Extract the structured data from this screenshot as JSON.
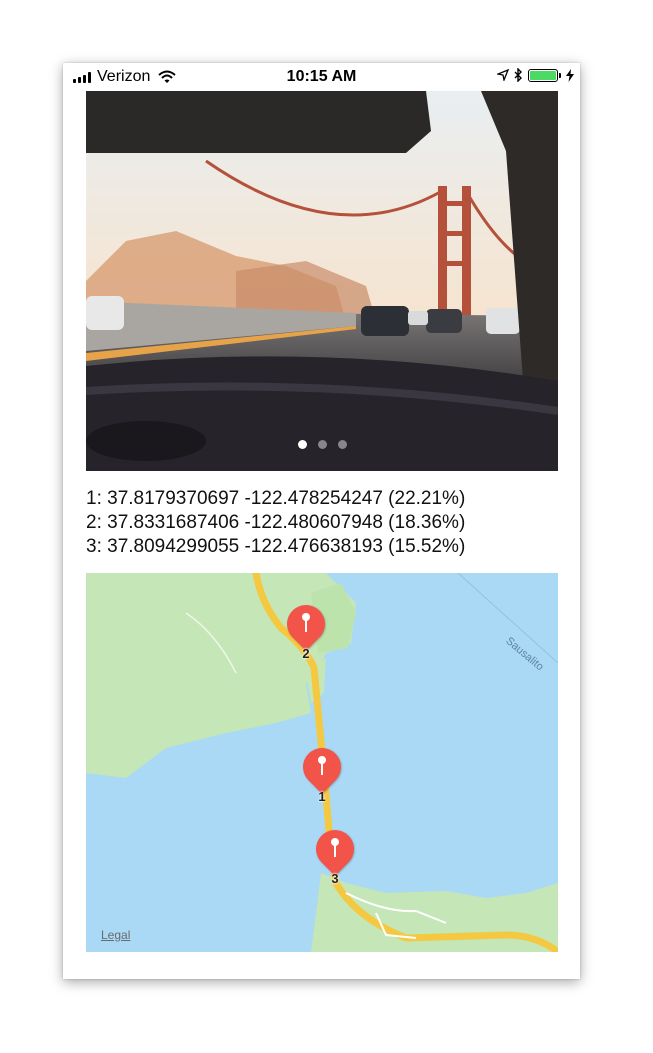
{
  "status_bar": {
    "carrier": "Verizon",
    "time": "10:15 AM",
    "battery_level": 1.0,
    "icons": [
      "signal-icon",
      "wifi-icon",
      "location-arrow-icon",
      "bluetooth-icon",
      "battery-icon",
      "charging-bolt-icon"
    ]
  },
  "carousel": {
    "page_count": 3,
    "active_index": 0
  },
  "results": [
    "1: 37.8179370697 -122.478254247 (22.21%)",
    "2: 37.8331687406 -122.480607948 (18.36%)",
    "3: 37.8094299055 -122.476638193 (15.52%)"
  ],
  "map": {
    "place_label": "Sausalito",
    "legal_label": "Legal",
    "pins": [
      {
        "label": "2"
      },
      {
        "label": "1"
      },
      {
        "label": "3"
      }
    ],
    "colors": {
      "water": "#aad9f5",
      "land": "#c5e6b6",
      "road": "#f5c842",
      "pin": "#f2544a"
    }
  }
}
